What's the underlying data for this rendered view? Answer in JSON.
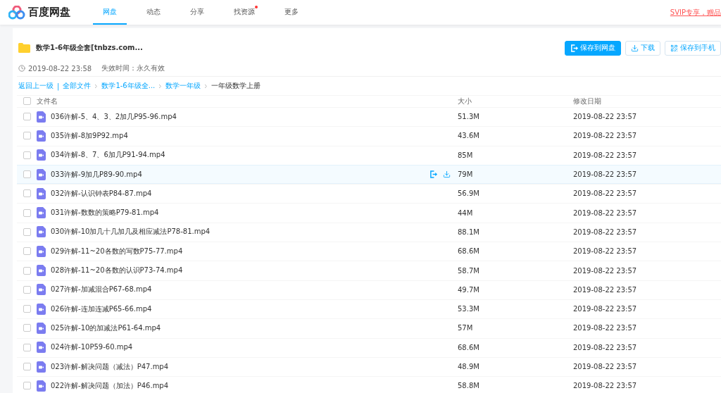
{
  "header": {
    "logo": "百度网盘",
    "nav": [
      {
        "label": "网盘",
        "selected": true,
        "badge": false
      },
      {
        "label": "动态",
        "selected": false,
        "badge": false
      },
      {
        "label": "分享",
        "selected": false,
        "badge": false
      },
      {
        "label": "找资源",
        "selected": false,
        "badge": true
      },
      {
        "label": "更多",
        "selected": false,
        "badge": false
      }
    ],
    "promo": "SVIP专享，赠品"
  },
  "share": {
    "title": "数学1-6年级全套[tnbzs.com...",
    "buttons": [
      {
        "label": "保存到网盘",
        "kind": "save",
        "primary": true
      },
      {
        "label": "下载",
        "kind": "download",
        "primary": false
      },
      {
        "label": "保存到手机",
        "kind": "phone",
        "primary": false
      }
    ],
    "created": "2019-08-22 23:58",
    "expiry_label": "失效时间：",
    "expiry": "永久有效"
  },
  "breadcrumb": {
    "back": "返回上一级",
    "separator": "|",
    "items": [
      {
        "label": "全部文件",
        "link": true
      },
      {
        "label": "数学1-6年级全...",
        "link": true
      },
      {
        "label": "数学一年级",
        "link": true
      },
      {
        "label": "一年级数学上册",
        "link": false
      }
    ]
  },
  "table": {
    "columns": [
      "文件名",
      "大小",
      "修改日期"
    ],
    "all_checked": false,
    "rows": [
      {
        "name": "036许解-5、4、3、2加几P95-96.mp4",
        "size": "51.3M",
        "date": "2019-08-22 23:57",
        "checked": false,
        "hovered": false
      },
      {
        "name": "035许解-8加9P92.mp4",
        "size": "43.6M",
        "date": "2019-08-22 23:57",
        "checked": false,
        "hovered": false
      },
      {
        "name": "034许解-8、7、6加几P91-94.mp4",
        "size": "85M",
        "date": "2019-08-22 23:57",
        "checked": false,
        "hovered": false
      },
      {
        "name": "033许解-9加几P89-90.mp4",
        "size": "79M",
        "date": "2019-08-22 23:57",
        "checked": false,
        "hovered": true
      },
      {
        "name": "032许解-认识钟表P84-87.mp4",
        "size": "56.9M",
        "date": "2019-08-22 23:57",
        "checked": false,
        "hovered": false
      },
      {
        "name": "031许解-数数的策略P79-81.mp4",
        "size": "44M",
        "date": "2019-08-22 23:57",
        "checked": false,
        "hovered": false
      },
      {
        "name": "030许解-10加几十几加几及相应减法P78-81.mp4",
        "size": "88.1M",
        "date": "2019-08-22 23:57",
        "checked": false,
        "hovered": false
      },
      {
        "name": "029许解-11~20各数的写数P75-77.mp4",
        "size": "68.6M",
        "date": "2019-08-22 23:57",
        "checked": false,
        "hovered": false
      },
      {
        "name": "028许解-11~20各数的认识P73-74.mp4",
        "size": "58.7M",
        "date": "2019-08-22 23:57",
        "checked": false,
        "hovered": false
      },
      {
        "name": "027许解-加减混合P67-68.mp4",
        "size": "49.7M",
        "date": "2019-08-22 23:57",
        "checked": false,
        "hovered": false
      },
      {
        "name": "026许解-连加连减P65-66.mp4",
        "size": "53.3M",
        "date": "2019-08-22 23:57",
        "checked": false,
        "hovered": false
      },
      {
        "name": "025许解-10的加减法P61-64.mp4",
        "size": "57M",
        "date": "2019-08-22 23:57",
        "checked": false,
        "hovered": false
      },
      {
        "name": "024许解-10P59-60.mp4",
        "size": "68.6M",
        "date": "2019-08-22 23:57",
        "checked": false,
        "hovered": false
      },
      {
        "name": "023许解-解决问题（减法）P47.mp4",
        "size": "48.9M",
        "date": "2019-08-22 23:57",
        "checked": false,
        "hovered": false
      },
      {
        "name": "022许解-解决问题（加法）P46.mp4",
        "size": "58.8M",
        "date": "2019-08-22 23:57",
        "checked": false,
        "hovered": false
      }
    ]
  }
}
